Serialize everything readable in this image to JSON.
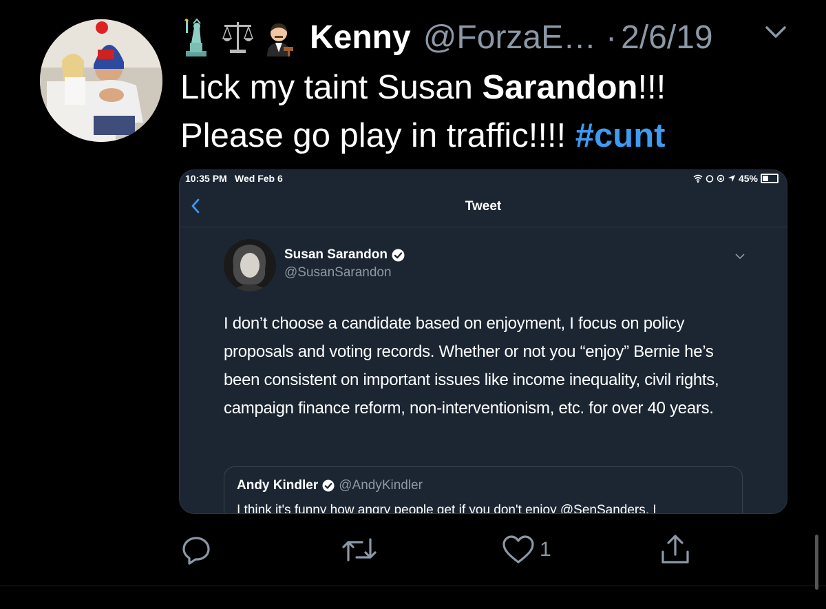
{
  "tweet": {
    "author_name": "Kenny",
    "author_handle": "@ForzaE…",
    "dot": "·",
    "date": "2/6/19",
    "text_part1": "Lick my taint Susan ",
    "text_bold": "Sarandon",
    "text_part2": "!!!",
    "text_line2": "Please go play in traffic!!!! ",
    "hashtag": "#cunt",
    "header_icons": [
      "statue-of-liberty-icon",
      "balance-scale-icon",
      "judge-icon"
    ]
  },
  "embedded": {
    "status_time": "10:35 PM",
    "status_day": "Wed Feb 6",
    "battery": "45%",
    "nav_title": "Tweet",
    "author_name": "Susan Sarandon",
    "author_handle": "@SusanSarandon",
    "body": "I don’t choose a candidate based on enjoyment, I focus on policy proposals and voting records. Whether or not you “enjoy” Bernie he’s been consistent on important issues like income inequality, civil rights, campaign finance reform, non-interventionism, etc. for over 40 years.",
    "quote": {
      "author_name": "Andy Kindler",
      "author_handle": "@AndyKindler",
      "text": "I think it's funny how angry people get if you don't enjoy @SenSanders. I"
    }
  },
  "actions": {
    "like_count": "1"
  },
  "colors": {
    "background": "#000000",
    "secondary_text": "#8b98a5",
    "link": "#3d9bf1",
    "embed_bg": "#1c2633"
  }
}
